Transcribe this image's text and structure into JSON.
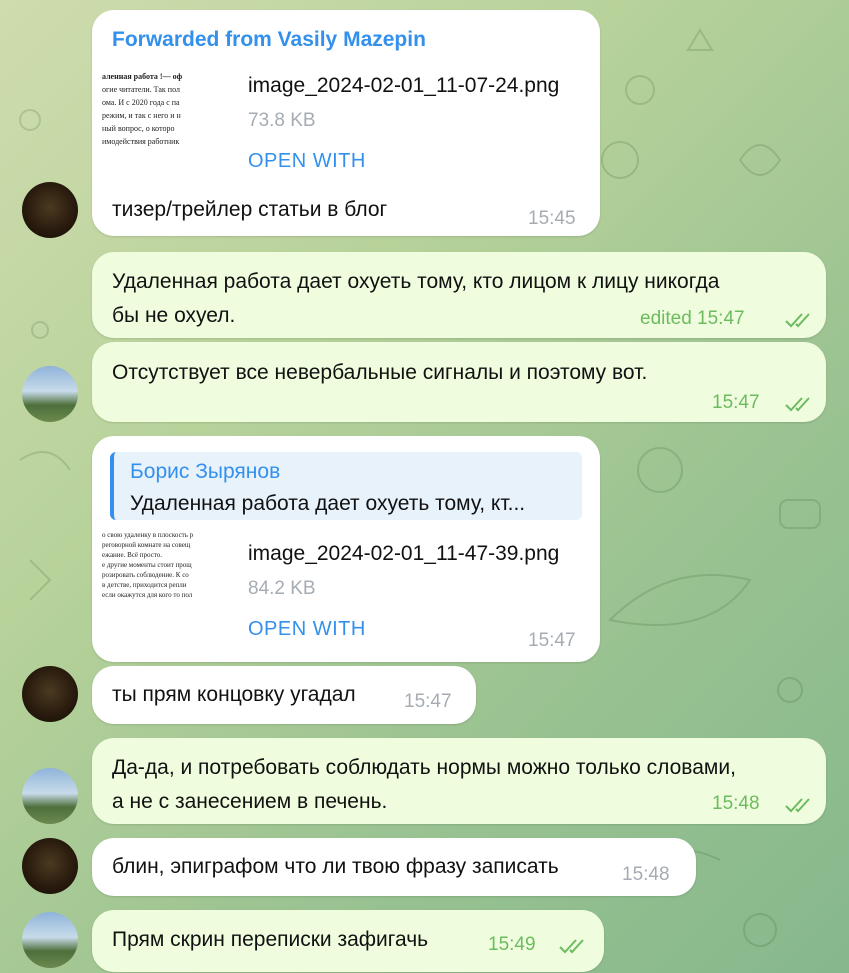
{
  "messages": [
    {
      "forwarded_label": "Forwarded from Vasily Mazepin",
      "file_name": "image_2024-02-01_11-07-24.png",
      "file_size": "73.8 KB",
      "open_with": "OPEN WITH",
      "thumb_lines": [
        "аленная работа !— оф",
        "огие читатели. Так пол",
        "ома. И с 2020 года с па",
        "режим, и так с него и н",
        "ный вопрос, о которо",
        "имодействия работник"
      ],
      "text": "тизер/трейлер статьи в блог",
      "time": "15:45"
    },
    {
      "text_lines": [
        "Удаленная работа дает охуеть тому, кто лицом к лицу никогда",
        "бы не охуел."
      ],
      "time": "edited 15:47"
    },
    {
      "text": "Отсутствует все невербальные сигналы и поэтому вот.",
      "time": "15:47"
    },
    {
      "reply_name": "Борис Зырянов",
      "reply_text": "Удаленная работа дает охуеть тому, кт...",
      "file_name": "image_2024-02-01_11-47-39.png",
      "file_size": "84.2 KB",
      "open_with": "OPEN WITH",
      "thumb_lines": [
        "о свою удаленку в плоскость р",
        "реговорной комнате на совещ",
        "ежание. Всё просто.",
        "",
        "е другие моменты стоит прощ",
        "розировать соблюдение. К со",
        "в детстве, приходится репли",
        "",
        "",
        "если окажутся для кого то пол"
      ],
      "time": "15:47"
    },
    {
      "text": "ты прям концовку угадал",
      "time": "15:47"
    },
    {
      "text_lines": [
        "Да-да, и потребовать соблюдать нормы можно только словами,",
        "а не с занесением в печень."
      ],
      "time": "15:48"
    },
    {
      "text": "блин, эпиграфом что ли твою фразу записать",
      "time": "15:48"
    },
    {
      "text": "Прям скрин переписки зафигачь",
      "time": "15:49"
    }
  ]
}
